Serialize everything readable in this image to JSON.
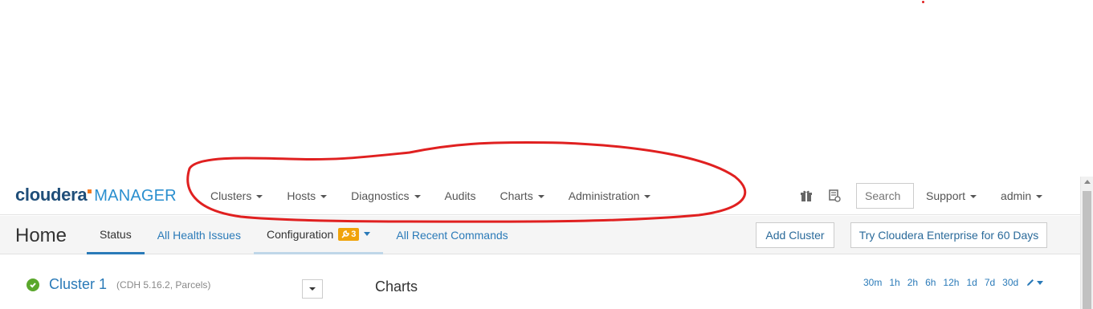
{
  "logo": {
    "brand": "cloudera",
    "product": "MANAGER"
  },
  "nav": {
    "items": [
      {
        "label": "Clusters",
        "has_caret": true
      },
      {
        "label": "Hosts",
        "has_caret": true
      },
      {
        "label": "Diagnostics",
        "has_caret": true
      },
      {
        "label": "Audits",
        "has_caret": false
      },
      {
        "label": "Charts",
        "has_caret": true
      },
      {
        "label": "Administration",
        "has_caret": true
      }
    ],
    "search_placeholder": "Search",
    "support_label": "Support",
    "user_label": "admin",
    "icons": [
      "gift-icon",
      "running-commands-icon"
    ]
  },
  "subheader": {
    "title": "Home",
    "tabs": [
      {
        "label": "Status",
        "active": true
      },
      {
        "label": "All Health Issues",
        "active": false
      },
      {
        "label": "Configuration",
        "active": false,
        "badge": "3",
        "badge_icon": "wrench-icon"
      },
      {
        "label": "All Recent Commands",
        "active": false
      }
    ],
    "add_cluster_label": "Add Cluster",
    "trial_label": "Try Cloudera Enterprise for 60 Days"
  },
  "content": {
    "cluster_name": "Cluster 1",
    "cluster_meta": "(CDH 5.16.2, Parcels)",
    "charts_title": "Charts",
    "time_ranges": [
      "30m",
      "1h",
      "2h",
      "6h",
      "12h",
      "1d",
      "7d",
      "30d"
    ]
  },
  "colors": {
    "accent": "#2a7ab8",
    "brand_dark": "#1f4e79",
    "brand_light": "#2a8fcf",
    "badge": "#f0a30a",
    "health_ok": "#5aa72c",
    "annotation": "#e02020"
  }
}
